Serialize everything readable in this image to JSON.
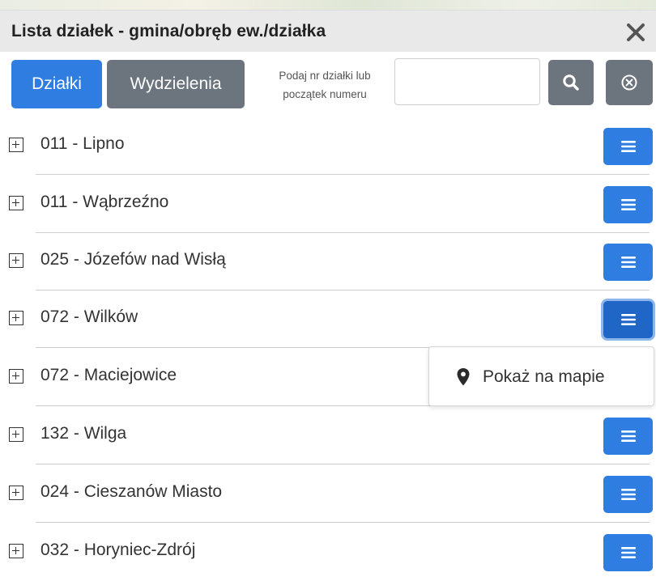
{
  "panel": {
    "title": "Lista działek - gmina/obręb ew./działka",
    "close_icon": "close-icon"
  },
  "toolbar": {
    "tab_dzialki": "Działki",
    "tab_wydzielenia": "Wydzielenia",
    "hint_line1": "Podaj nr działki lub",
    "hint_line2": "początek numeru",
    "search_value": "",
    "search_icon": "search-icon",
    "clear_icon": "clear-circle-icon"
  },
  "rows": [
    {
      "label": "011 - Lipno"
    },
    {
      "label": "011 - Wąbrzeźno"
    },
    {
      "label": "025 - Józefów nad Wisłą"
    },
    {
      "label": "072 - Wilków"
    },
    {
      "label": "072 - Maciejowice"
    },
    {
      "label": "132 - Wilga"
    },
    {
      "label": "024 - Cieszanów Miasto"
    },
    {
      "label": "032 - Horyniec-Zdrój"
    }
  ],
  "dropdown": {
    "item_label": "Pokaż na mapie",
    "item_icon": "map-marker-icon"
  },
  "colors": {
    "primary": "#2f7de1",
    "secondary": "#6c757d",
    "title_bg": "#e9e9e9"
  }
}
